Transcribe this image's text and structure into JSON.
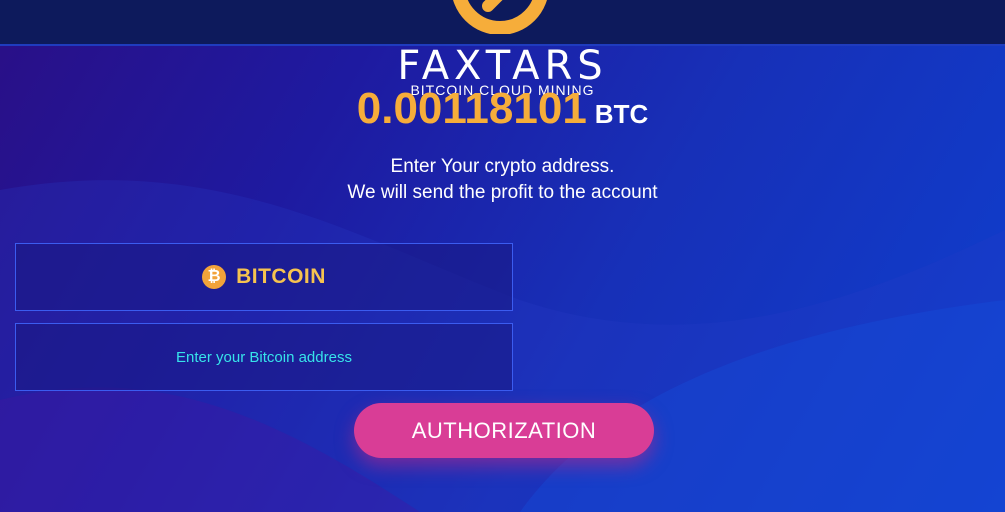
{
  "brand": {
    "name": "FAXTARS",
    "tagline": "BITCOIN CLOUD MINING",
    "logo_icon": "faxtars-logo-icon"
  },
  "balance": {
    "amount": "0.00118101",
    "unit": "BTC"
  },
  "instructions": {
    "line1": "Enter Your crypto address.",
    "line2": "We will send the profit to the account"
  },
  "currency": {
    "label": "BITCOIN",
    "icon": "bitcoin-icon",
    "symbol": "₿"
  },
  "address_input": {
    "placeholder": "Enter your Bitcoin address",
    "value": ""
  },
  "authorization_button": {
    "label": "AUTHORIZATION"
  },
  "colors": {
    "accent": "#f6ad3a",
    "button": "#d93d96",
    "placeholder": "#37e3ea",
    "border": "#3b5cf0"
  }
}
